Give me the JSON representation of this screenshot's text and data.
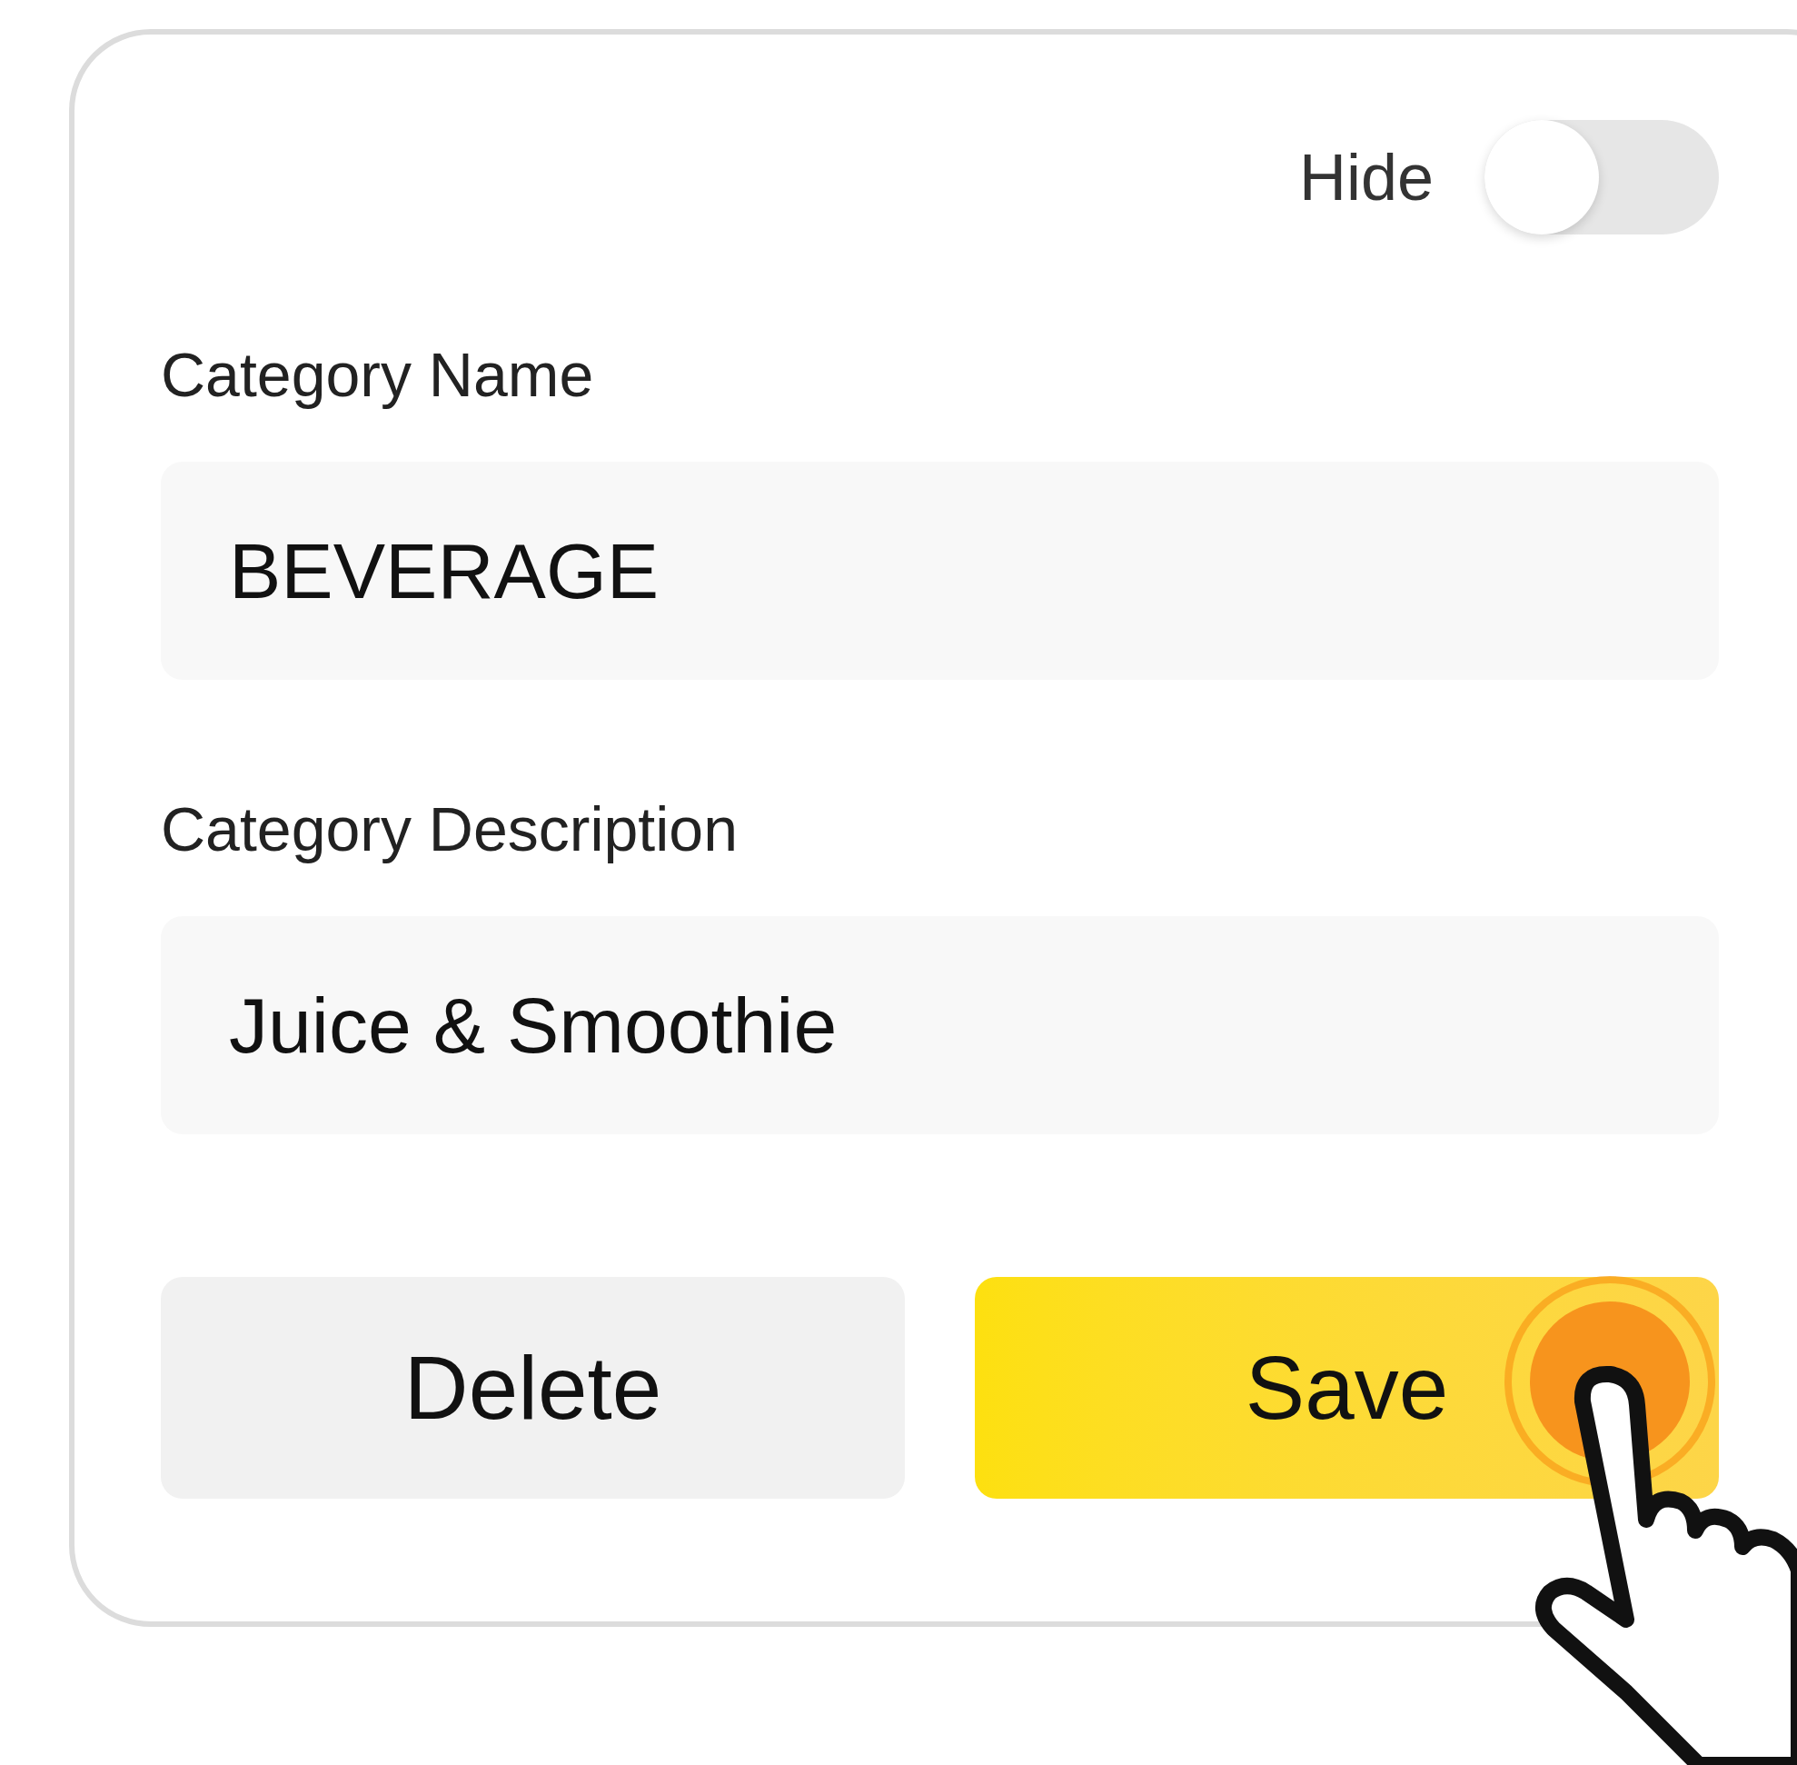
{
  "hide_toggle": {
    "label": "Hide",
    "on": false
  },
  "fields": [
    {
      "label": "Category Name",
      "value": "BEVERAGE"
    },
    {
      "label": "Category Description",
      "value": "Juice & Smoothie"
    }
  ],
  "buttons": [
    {
      "label": "Delete",
      "kind": "secondary"
    },
    {
      "label": "Save",
      "kind": "primary"
    }
  ]
}
